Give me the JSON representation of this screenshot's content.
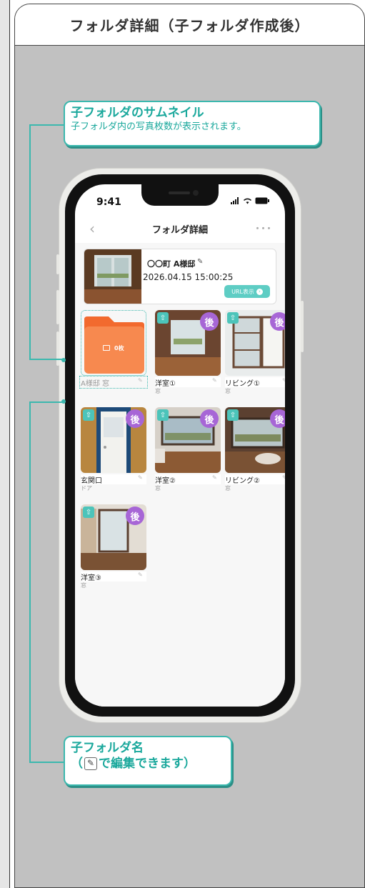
{
  "card": {
    "title": "フォルダ詳細（子フォルダ作成後）"
  },
  "callout_thumb": {
    "title": "子フォルダのサムネイル",
    "desc": "子フォルダ内の写真枚数が表示されます。"
  },
  "callout_name": {
    "title": "子フォルダ名",
    "open": "（",
    "desc": "で編集できます）"
  },
  "phone": {
    "time": "9:41",
    "nav_title": "フォルダ詳細",
    "back": "‹",
    "more": "･･･",
    "folder": {
      "name": "〇〇町 A様邸",
      "date": "2026.04.15 15:00:25",
      "url_button": "URL表示"
    },
    "child_folder": {
      "count": "0枚",
      "name": "A様邸 窓"
    },
    "photos": [
      {
        "title": "洋室①",
        "sub": "窓",
        "badge": "後"
      },
      {
        "title": "リビング①",
        "sub": "窓",
        "badge": "後"
      },
      {
        "title": "玄関口",
        "sub": "ドア",
        "badge": "後"
      },
      {
        "title": "洋室②",
        "sub": "窓",
        "badge": "後"
      },
      {
        "title": "リビング②",
        "sub": "窓",
        "badge": "後"
      },
      {
        "title": "洋室③",
        "sub": "窓",
        "badge": "後"
      }
    ]
  },
  "colors": {
    "teal": "#3bb8ae",
    "purple": "#a766d6",
    "folder_orange": "#f7894f",
    "background": "#c1c1c1"
  }
}
